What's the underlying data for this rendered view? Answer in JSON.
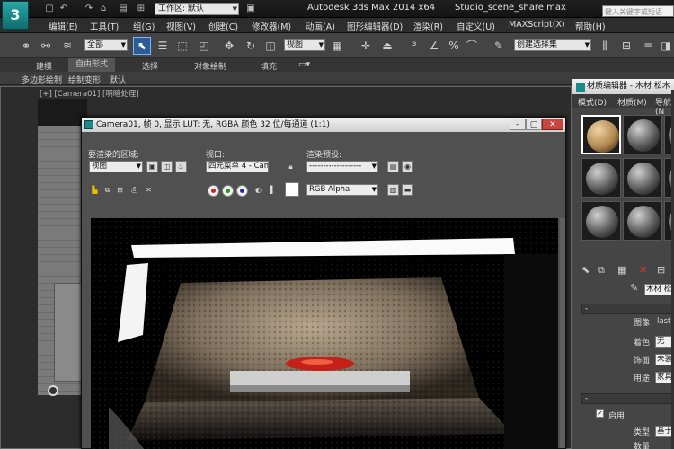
{
  "titlebar": {
    "logo": "3",
    "workspace": "工作区: 默认",
    "app_title": "Autodesk 3ds Max  2014 x64",
    "file_name": "Studio_scene_share.max",
    "search_placeholder": "键入关键字或短语",
    "quick_access": [
      "new-icon",
      "open-icon",
      "save-icon",
      "undo-icon",
      "redo-icon",
      "project-icon",
      "hold-icon"
    ]
  },
  "menubar": {
    "items": [
      "编辑(E)",
      "工具(T)",
      "组(G)",
      "视图(V)",
      "创建(C)",
      "修改器(M)",
      "动画(A)",
      "图形编辑器(D)",
      "渲染(R)",
      "自定义(U)",
      "MAXScript(X)",
      "帮助(H)"
    ]
  },
  "toolbar": {
    "selection_filter": "全部",
    "reference_coord": "视图",
    "named_selection": "创建选择集"
  },
  "ribbon": {
    "tabs": [
      "建模",
      "自由形式",
      "选择",
      "对象绘制",
      "填充"
    ],
    "active_tab": "自由形式",
    "sub_tabs": [
      "多边形绘制",
      "绘制变形",
      "默认"
    ]
  },
  "viewport": {
    "label": "[+] [Camera01] [明暗处理]"
  },
  "render_window": {
    "title": "Camera01, 帧 0, 显示 LUT: 无, RGBA 颜色 32 位/每通道 (1:1)",
    "area_label": "要渲染的区域:",
    "area_value": "视图",
    "viewport_label": "视口:",
    "viewport_value": "四元菜单 4 - Cam",
    "preset_label": "渲染预设:",
    "preset_value": "-------------------",
    "channel_value": "RGB Alpha",
    "color_dots": {
      "red": "#d42020",
      "green": "#1e9a1e",
      "blue": "#1c2fbf"
    }
  },
  "material_editor": {
    "title": "材质编辑器 - 木材 松木",
    "menu": [
      "模式(D)",
      "材质(M)",
      "导航(N"
    ],
    "material_name": "木材 松木",
    "rows": [
      {
        "label": "图像",
        "value": "lastic"
      },
      {
        "label": "着色",
        "value": "无"
      },
      {
        "label": "饰面",
        "value": "未装饰"
      },
      {
        "label": "用途",
        "value": "家具"
      }
    ],
    "enable_label": "启用",
    "type_label": "类型",
    "type_value": "基于",
    "amount_label": "数量"
  }
}
